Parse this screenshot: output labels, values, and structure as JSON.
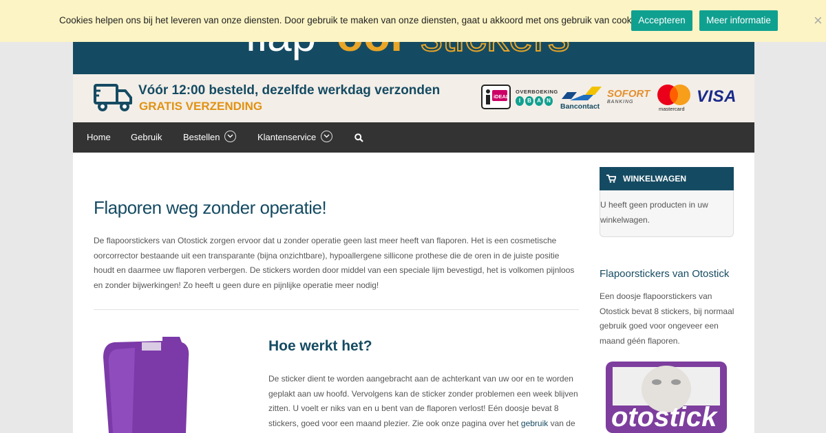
{
  "cookie": {
    "text": "Cookies helpen ons bij het leveren van onze diensten. Door gebruik te maken van onze diensten, gaat u akkoord met ons gebruik van cookies.",
    "accept_label": "Accepteren",
    "more_label": "Meer informatie",
    "close_glyph": "×"
  },
  "promo": {
    "line1": "Vóór 12:00 besteld, dezelfde werkdag verzonden",
    "line2": "GRATIS VERZENDING"
  },
  "payments": {
    "ideal": "iDEAL",
    "iban_top": "OVERBOEKING",
    "iban_letters": [
      "I",
      "B",
      "A",
      "N"
    ],
    "bancontact": "Bancontact",
    "sofort": "SOFORT",
    "sofort_sub": "BANKING",
    "mastercard": "mastercard",
    "visa": "VISA"
  },
  "nav": {
    "items": [
      {
        "label": "Home"
      },
      {
        "label": "Gebruik"
      },
      {
        "label": "Bestellen"
      },
      {
        "label": "Klantenservice"
      }
    ]
  },
  "main": {
    "title": "Flaporen weg zonder operatie!",
    "intro": "De flapoorstickers van Otostick zorgen ervoor dat u zonder operatie geen last meer heeft van flaporen. Het is een cosmetische oorcorrector bestaande uit een transparante (bijna onzichtbare), hypoallergene sillicone prothese die de oren in de juiste positie houdt en daarmee uw flaporen verbergen. De stickers worden door middel van een speciale lijm bevestigd, het is volkomen pijnloos en zonder bijwerkingen! Zo heeft u geen dure en pijnlijke operatie meer nodig!",
    "section_title": "Hoe werkt het?",
    "section_text": "De sticker dient te worden aangebracht aan de achterkant van uw oor en te worden geplakt aan uw hoofd. Vervolgens kan de sticker zonder problemen een week blijven zitten. U voelt er niks van en u bent van de flaporen verlost! Eén doosje bevat 8 stickers, goed voor een maand plezier. Zie ook onze pagina over het",
    "section_link": "gebruik",
    "section_tail": "van de"
  },
  "sidebar": {
    "cart_title": "WINKELWAGEN",
    "cart_text": "U heeft geen producten in uw winkelwagen.",
    "widget_title": "Flapoorstickers van Otostick",
    "widget_text": "Een doosje flapoorstickers van Otostick bevat 8 stickers, bij normaal gebruik goed voor ongeveer een maand géén flaporen.",
    "box_brand": "otostick"
  },
  "colors": {
    "brand_blue": "#154b62",
    "accent_orange": "#e9a526",
    "button_teal": "#10a090",
    "nav_bg": "#333333"
  }
}
